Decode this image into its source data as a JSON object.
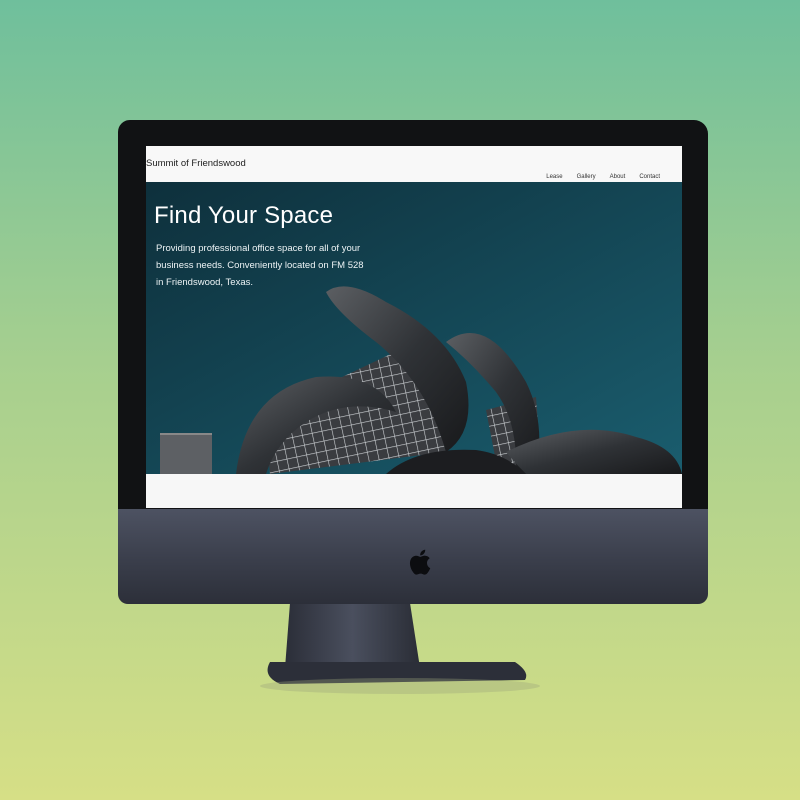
{
  "site": {
    "brand": "Summit of Friendswood"
  },
  "nav": {
    "items": [
      {
        "label": "Lease"
      },
      {
        "label": "Gallery"
      },
      {
        "label": "About"
      },
      {
        "label": "Contact"
      }
    ]
  },
  "hero": {
    "title": "Find Your Space",
    "text": "Providing professional office space for all of your business needs. Conveniently located on FM 528 in Friendswood, Texas."
  },
  "colors": {
    "background_top": "#6fbf9c",
    "background_bottom": "#d6df86",
    "hero_bg": "#124353",
    "navbar_bg": "#f8f8f8",
    "monitor_chin": "#3a3e4b"
  },
  "icons": {
    "logo": "apple-icon"
  }
}
